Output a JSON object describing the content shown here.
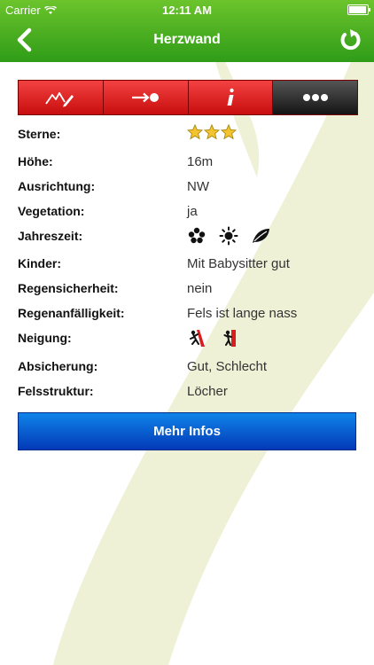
{
  "status_bar": {
    "carrier": "Carrier",
    "time": "12:11 AM"
  },
  "nav": {
    "title": "Herzwand",
    "back_icon": "chevron-left-icon",
    "refresh_icon": "refresh-icon"
  },
  "tabs": [
    {
      "icon": "mountain-pencil-icon",
      "active": false
    },
    {
      "icon": "arrow-to-point-icon",
      "active": false
    },
    {
      "icon": "info-icon",
      "active": false
    },
    {
      "icon": "more-dots-icon",
      "active": true
    }
  ],
  "details": {
    "sterne": {
      "label": "Sterne:",
      "stars": 3
    },
    "hoehe": {
      "label": "Höhe:",
      "value": "16m"
    },
    "ausrichtung": {
      "label": "Ausrichtung:",
      "value": "NW"
    },
    "vegetation": {
      "label": "Vegetation:",
      "value": "ja"
    },
    "jahreszeit": {
      "label": "Jahreszeit:",
      "icons": [
        "flower-icon",
        "sun-icon",
        "leaf-icon"
      ]
    },
    "kinder": {
      "label": "Kinder:",
      "value": "Mit Babysitter gut"
    },
    "regensicherheit": {
      "label": "Regensicherheit:",
      "value": "nein"
    },
    "regenanfaelligkeit": {
      "label": "Regenanfälligkeit:",
      "value": "Fels ist lange nass"
    },
    "neigung": {
      "label": "Neigung:",
      "icons": [
        "climber-slab-icon",
        "climber-vertical-icon"
      ]
    },
    "absicherung": {
      "label": "Absicherung:",
      "value": "Gut, Schlecht"
    },
    "felsstruktur": {
      "label": "Felsstruktur:",
      "value": "Löcher"
    }
  },
  "more_button": {
    "label": "Mehr Infos"
  },
  "colors": {
    "nav_green": "#3fa81e",
    "tab_red": "#e02020",
    "button_blue": "#0a5fd6",
    "background_stroke": "#eef1d6"
  }
}
